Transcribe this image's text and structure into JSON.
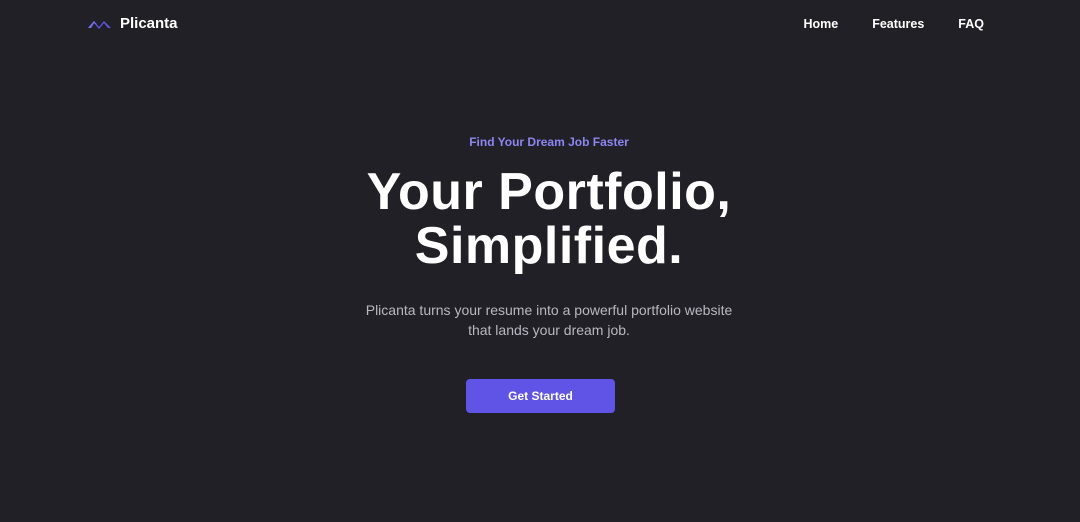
{
  "nav": {
    "brand": "Plicanta",
    "links": [
      "Home",
      "Features",
      "FAQ"
    ]
  },
  "hero": {
    "eyebrow": "Find Your Dream Job Faster",
    "headline_line1": "Your Portfolio,",
    "headline_line2": "Simplified.",
    "subtitle_line1": "Plicanta turns your resume into a powerful portfolio website",
    "subtitle_line2": "that lands your dream job.",
    "cta_label": "Get Started"
  },
  "icons": {
    "logo": "logo-mark-icon"
  },
  "colors": {
    "background": "#212027",
    "accent": "#5f54e6",
    "eyebrow": "#8c86f2",
    "text": "#ffffff",
    "muted_text": "#b9b8c0"
  }
}
